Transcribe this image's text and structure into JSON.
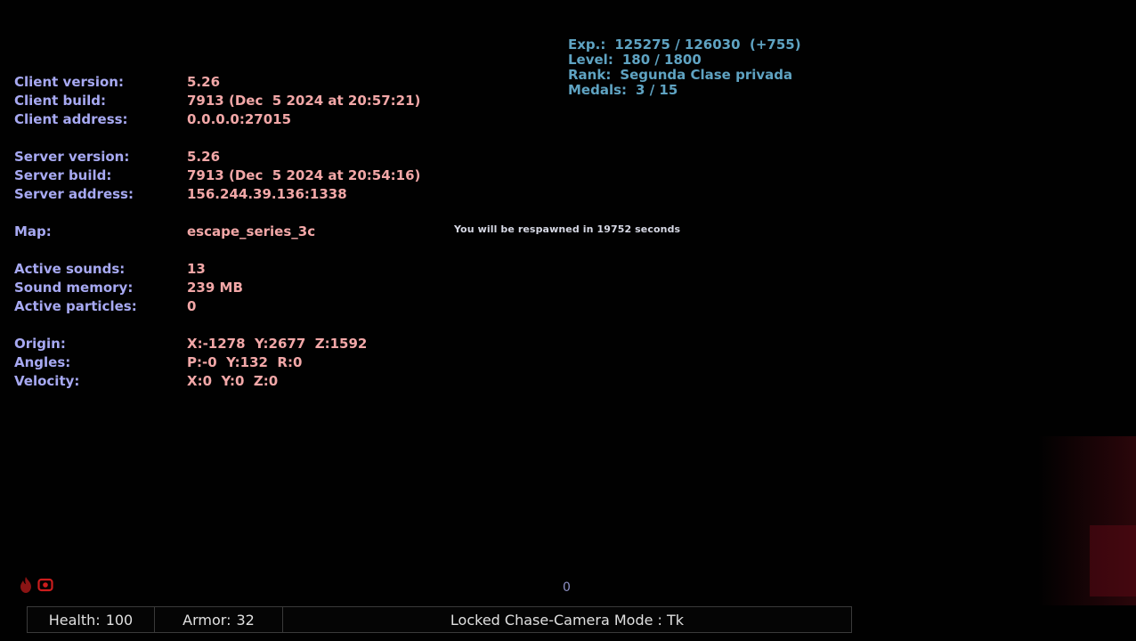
{
  "stats": {
    "exp_label": "Exp.:",
    "exp_value": "125275 / 126030  (+755)",
    "level_label": "Level:",
    "level_value": "180 / 1800",
    "rank_label": "Rank:",
    "rank_value": "Segunda Clase privada",
    "medals_label": "Medals:",
    "medals_value": "3 / 15"
  },
  "debug": {
    "client_version_label": "Client version:",
    "client_version": "5.26",
    "client_build_label": "Client build:",
    "client_build": "7913 (Dec  5 2024 at 20:57:21)",
    "client_address_label": "Client address:",
    "client_address": "0.0.0.0:27015",
    "server_version_label": "Server version:",
    "server_version": "5.26",
    "server_build_label": "Server build:",
    "server_build": "7913 (Dec  5 2024 at 20:54:16)",
    "server_address_label": "Server address:",
    "server_address": "156.244.39.136:1338",
    "map_label": "Map:",
    "map": "escape_series_3c",
    "active_sounds_label": "Active sounds:",
    "active_sounds": "13",
    "sound_memory_label": "Sound memory:",
    "sound_memory": "239 MB",
    "active_particles_label": "Active particles:",
    "active_particles": "0",
    "origin_label": "Origin:",
    "origin": "X:-1278  Y:2677  Z:1592",
    "angles_label": "Angles:",
    "angles": "P:-0  Y:132  R:0",
    "velocity_label": "Velocity:",
    "velocity": "X:0  Y:0  Z:0"
  },
  "respawn_message": "You will be respawned in 19752 seconds",
  "center_counter": "0",
  "hud": {
    "health_label": "Health:",
    "health_value": "100",
    "armor_label": "Armor:",
    "armor_value": "32",
    "mode_text": "Locked Chase-Camera Mode : Tk"
  },
  "icons": [
    "flame-icon",
    "camera-record-icon"
  ],
  "colors": {
    "label": "#a7a9f2",
    "value": "#f2a7a7",
    "stats": "#5fa3c2",
    "icon_red": "#cc1d1d"
  }
}
